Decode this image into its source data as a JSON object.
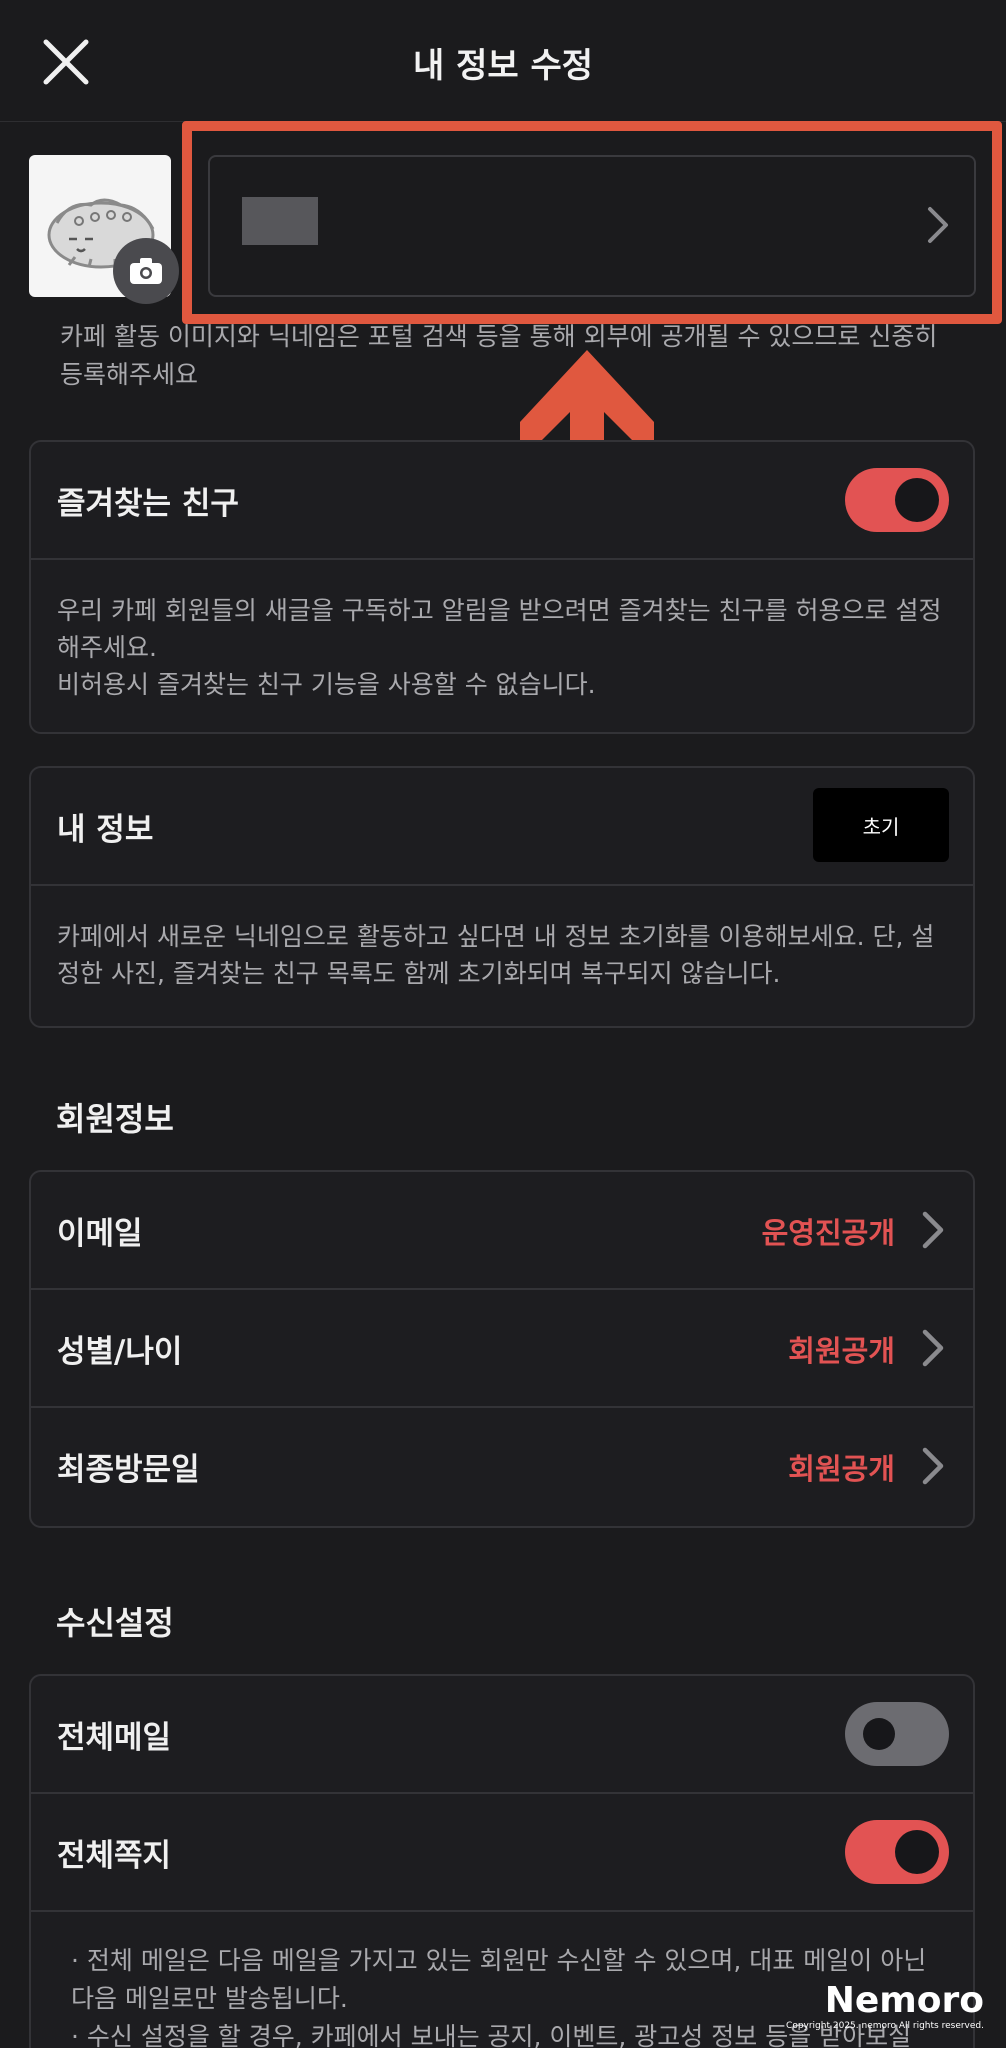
{
  "header": {
    "title": "내 정보 수정"
  },
  "profile": {
    "notice": "카페 활동 이미지와 닉네임은 포털 검색 등을 통해 외부에 공개될 수 있으므로 신중히 등록해주세요"
  },
  "favorites": {
    "label": "즐겨찾는 친구",
    "toggle_on": true,
    "description_1": "우리 카페 회원들의 새글을 구독하고 알림을 받으려면 즐겨찾는 친구를 허용으로 설정해주세요.",
    "description_2": "비허용시 즐겨찾는 친구 기능을 사용할 수 없습니다."
  },
  "my_info": {
    "label": "내 정보",
    "reset_label": "초기",
    "description": "카페에서 새로운 닉네임으로 활동하고 싶다면 내 정보 초기화를 이용해보세요. 단, 설정한 사진, 즐겨찾는 친구 목록도 함께 초기화되며 복구되지 않습니다."
  },
  "member_info": {
    "section_title": "회원정보",
    "rows": [
      {
        "label": "이메일",
        "value": "운영진공개"
      },
      {
        "label": "성별/나이",
        "value": "회원공개"
      },
      {
        "label": "최종방문일",
        "value": "회원공개"
      }
    ]
  },
  "receive_settings": {
    "section_title": "수신설정",
    "rows": [
      {
        "label": "전체메일",
        "toggle_on": false
      },
      {
        "label": "전체쪽지",
        "toggle_on": true
      }
    ],
    "note_1": "· 전체 메일은 다음 메일을 가지고 있는 회원만 수신할 수 있으며, 대표 메일이 아닌 다음 메일로만 발송됩니다.",
    "note_2": "· 수신 설정을 할 경우, 카페에서 보내는 공지, 이벤트, 광고성 정보 등을 받아보실 수"
  },
  "watermark": {
    "brand": "Nemoro",
    "copyright": "Copyright 2025. nemoro All rights reserved."
  },
  "colors": {
    "accent": "#e25353",
    "highlight": "#e0583f",
    "background": "#1b1b1d"
  }
}
